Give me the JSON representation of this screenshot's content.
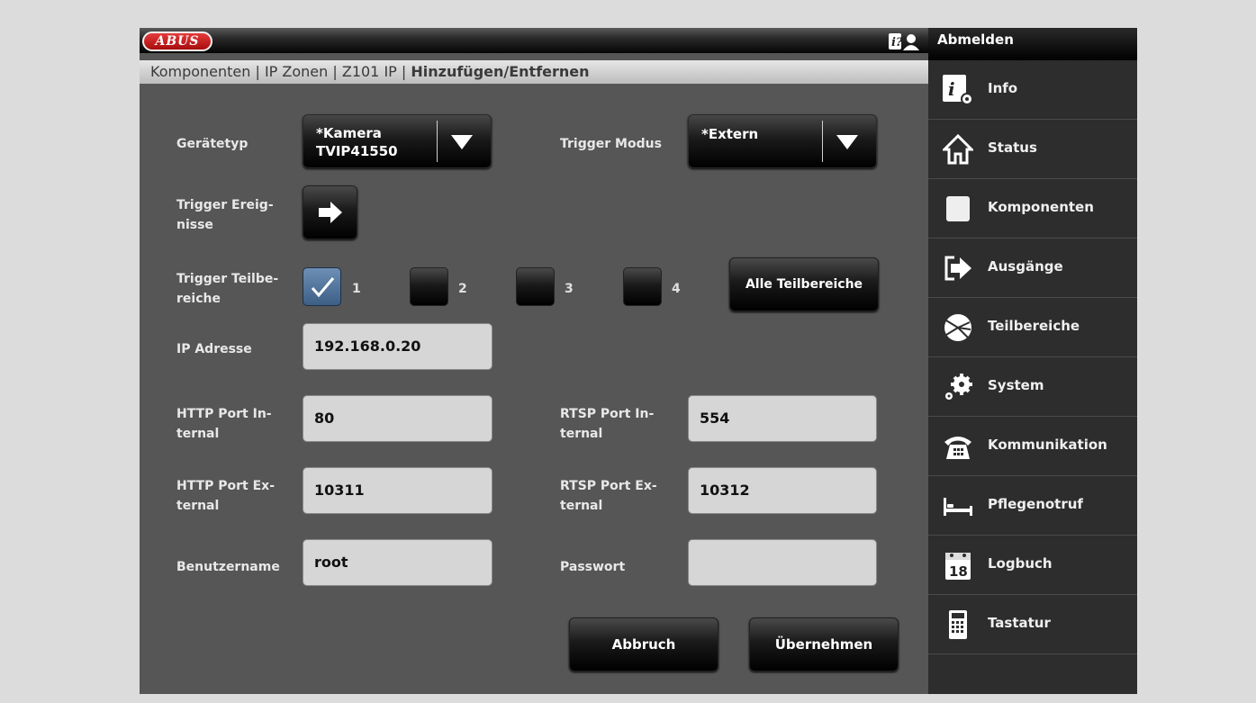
{
  "header": {
    "logo_text": "ABUS"
  },
  "breadcrumb": {
    "path": "Komponenten | IP Zonen | Z101 IP | ",
    "current": "Hinzufügen/Entfernen"
  },
  "form": {
    "geraetetyp_label": "Gerätetyp",
    "geraetetyp_line1": "*Kamera",
    "geraetetyp_line2": "TVIP41550",
    "trigger_modus_label": "Trigger Modus",
    "trigger_modus_value": "*Extern",
    "trigger_ereignisse_label_1": "Trigger Ereig-",
    "trigger_ereignisse_label_2": "nisse",
    "trigger_teilbereiche_label_1": "Trigger Teilbe-",
    "trigger_teilbereiche_label_2": "reiche",
    "partitions": [
      {
        "num": "1",
        "checked": true
      },
      {
        "num": "2",
        "checked": false
      },
      {
        "num": "3",
        "checked": false
      },
      {
        "num": "4",
        "checked": false
      }
    ],
    "alle_teilbereiche": "Alle Teilbereiche",
    "ip_label": "IP Adresse",
    "ip_value": "192.168.0.20",
    "http_int_label_1": "HTTP Port In-",
    "http_int_label_2": "ternal",
    "http_int_value": "80",
    "rtsp_int_label_1": "RTSP Port In-",
    "rtsp_int_label_2": "ternal",
    "rtsp_int_value": "554",
    "http_ext_label_1": "HTTP Port Ex-",
    "http_ext_label_2": "ternal",
    "http_ext_value": "10311",
    "rtsp_ext_label_1": "RTSP Port Ex-",
    "rtsp_ext_label_2": "ternal",
    "rtsp_ext_value": "10312",
    "user_label": "Benutzername",
    "user_value": "root",
    "pass_label": "Passwort",
    "pass_value": "",
    "cancel": "Abbruch",
    "apply": "Übernehmen"
  },
  "sidebar": {
    "logout": "Abmelden",
    "items": [
      {
        "label": "Info",
        "icon": "info-icon"
      },
      {
        "label": "Status",
        "icon": "home-icon"
      },
      {
        "label": "Komponenten",
        "icon": "square-icon"
      },
      {
        "label": "Ausgänge",
        "icon": "exit-icon"
      },
      {
        "label": "Teilbereiche",
        "icon": "pie-icon"
      },
      {
        "label": "System",
        "icon": "gear-icon"
      },
      {
        "label": "Kommunikation",
        "icon": "phone-icon"
      },
      {
        "label": "Pflegenotruf",
        "icon": "bed-icon"
      },
      {
        "label": "Logbuch",
        "icon": "calendar-icon"
      },
      {
        "label": "Tastatur",
        "icon": "keypad-icon"
      }
    ]
  },
  "colors": {
    "accent_red": "#c41a1a",
    "checkbox_blue": "#5a7ca3",
    "panel": "#565656"
  }
}
